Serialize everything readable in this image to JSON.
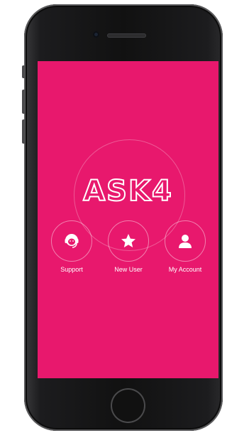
{
  "app": {
    "logo_text": "ASK4",
    "brand_color": "#e8186d"
  },
  "actions": [
    {
      "label": "Support",
      "icon": "support-headset-icon"
    },
    {
      "label": "New User",
      "icon": "star-icon"
    },
    {
      "label": "My Account",
      "icon": "user-icon"
    }
  ]
}
